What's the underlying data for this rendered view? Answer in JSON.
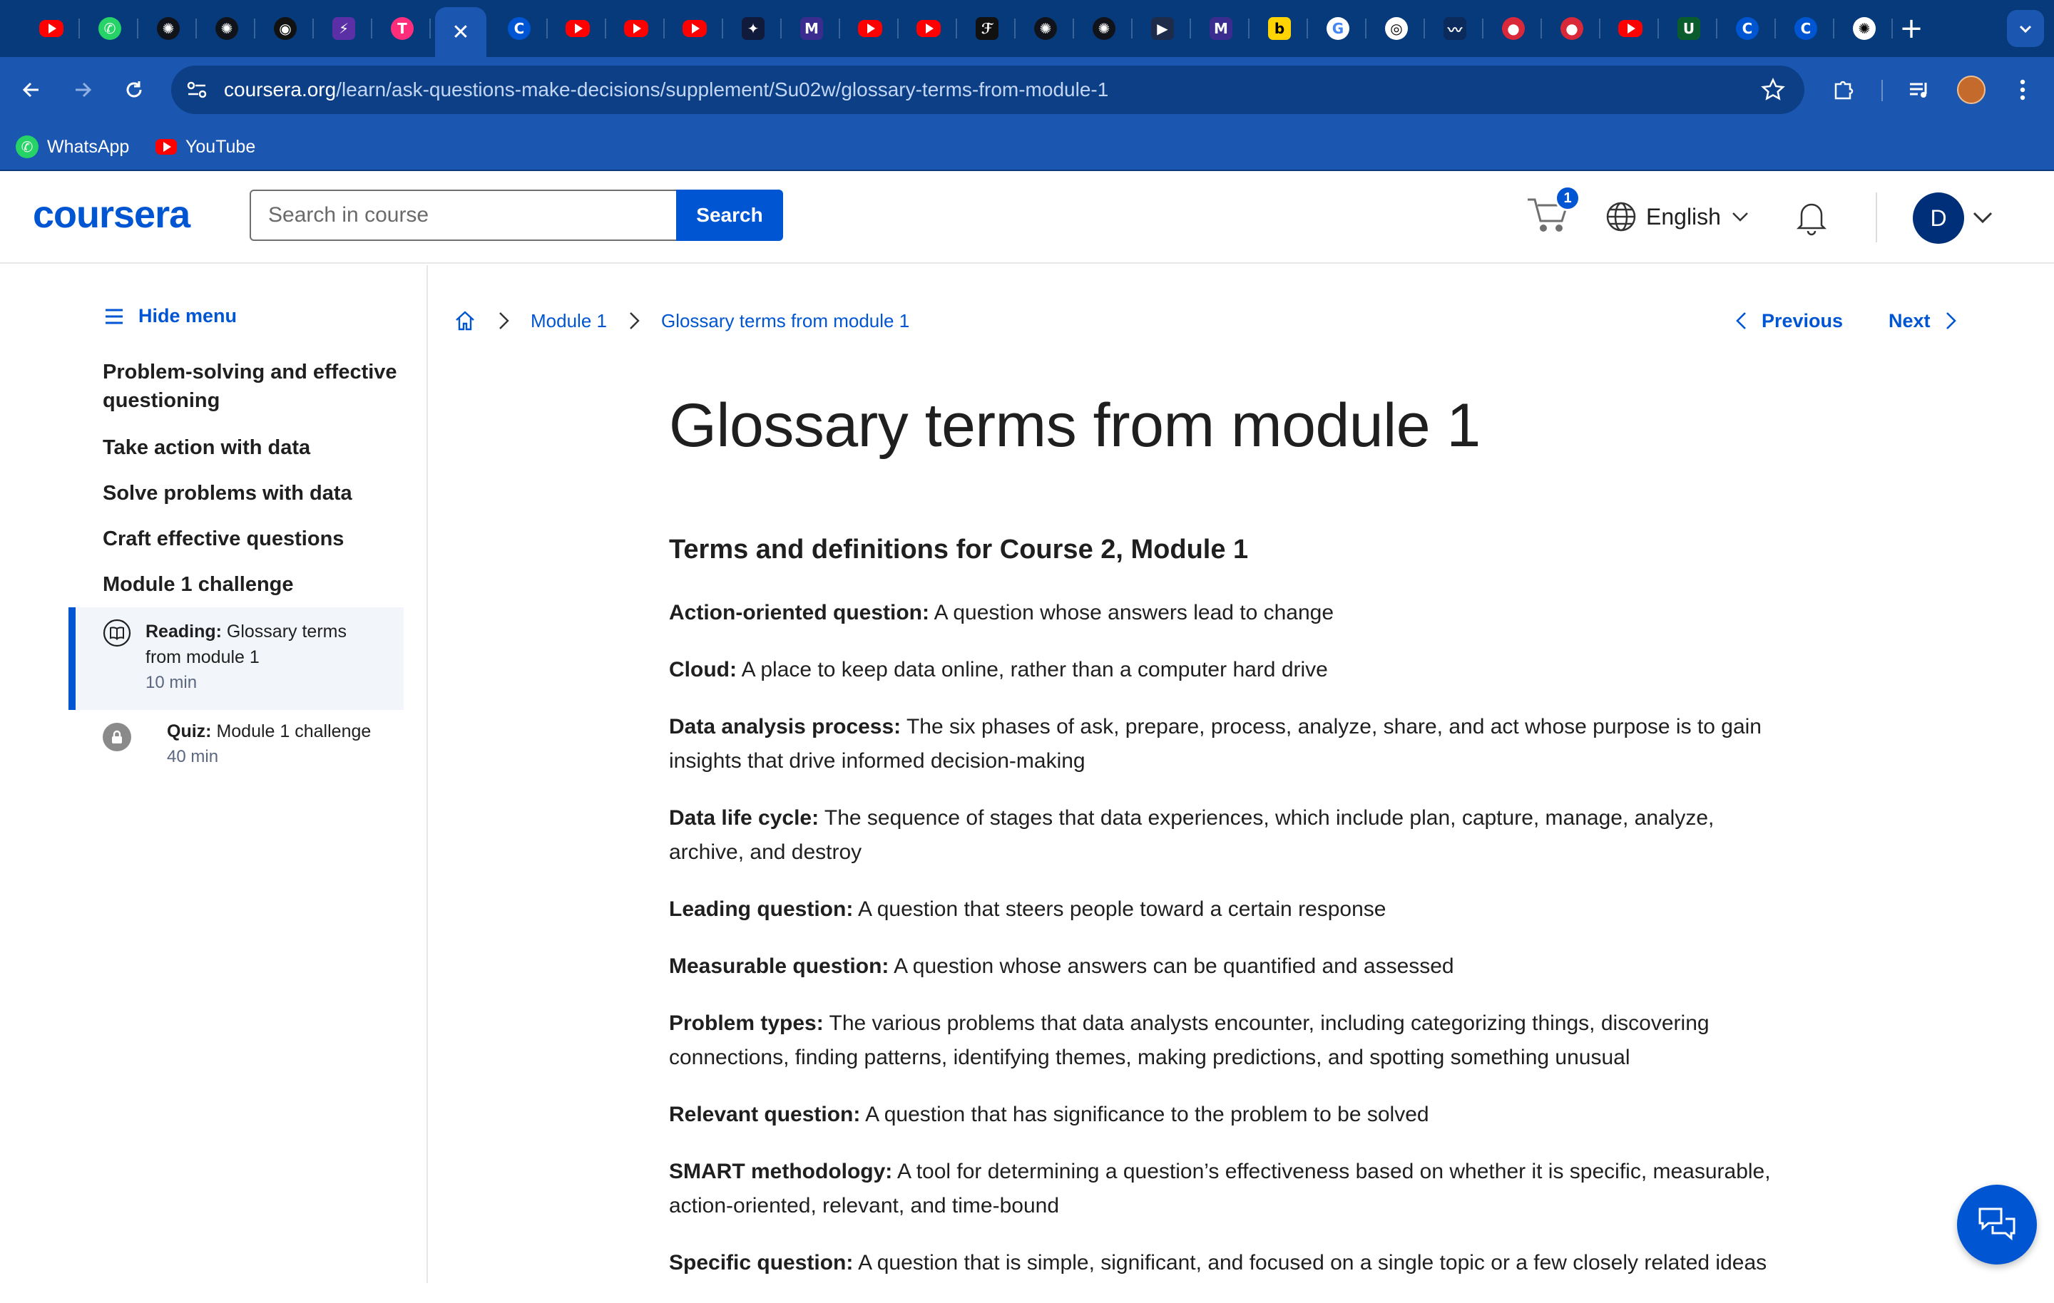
{
  "browser": {
    "tabs": [
      {
        "icon": "youtube-icon",
        "kind": "yt"
      },
      {
        "icon": "whatsapp-icon",
        "kind": "round",
        "color": "#25d366",
        "glyph": "✆"
      },
      {
        "icon": "openai-icon",
        "kind": "round",
        "color": "#10141a",
        "glyph": "✺"
      },
      {
        "icon": "openai-icon",
        "kind": "round",
        "color": "#10141a",
        "glyph": "✺"
      },
      {
        "icon": "github-icon",
        "kind": "round",
        "color": "#111111",
        "glyph": "◉"
      },
      {
        "icon": "flow-icon",
        "kind": "sq",
        "color": "#5b2fa6",
        "glyph": "⚡"
      },
      {
        "icon": "t-app-icon",
        "kind": "round",
        "color": "#ff2d7a",
        "glyph": "T"
      },
      {
        "icon": "close-tab-icon",
        "kind": "active",
        "glyph": "✕"
      },
      {
        "icon": "coursera-icon",
        "kind": "round",
        "color": "#0056d2",
        "glyph": "C"
      },
      {
        "icon": "youtube-icon",
        "kind": "yt"
      },
      {
        "icon": "youtube-icon",
        "kind": "yt"
      },
      {
        "icon": "youtube-icon",
        "kind": "yt"
      },
      {
        "icon": "space-icon",
        "kind": "sq",
        "color": "#101a3a",
        "glyph": "✦"
      },
      {
        "icon": "m-logo-icon",
        "kind": "sq",
        "color": "#3b2c8f",
        "glyph": "M"
      },
      {
        "icon": "youtube-icon",
        "kind": "yt"
      },
      {
        "icon": "youtube-icon",
        "kind": "yt"
      },
      {
        "icon": "signature-icon",
        "kind": "sq",
        "color": "#111111",
        "glyph": "ℱ"
      },
      {
        "icon": "openai-icon",
        "kind": "round",
        "color": "#10141a",
        "glyph": "✺"
      },
      {
        "icon": "openai-icon",
        "kind": "round",
        "color": "#10141a",
        "glyph": "✺"
      },
      {
        "icon": "video-icon",
        "kind": "sq",
        "color": "#1c2c4a",
        "glyph": "▶"
      },
      {
        "icon": "m-logo-icon",
        "kind": "sq",
        "color": "#3b2c8f",
        "glyph": "M"
      },
      {
        "icon": "b-logo-icon",
        "kind": "sq",
        "color": "#ffd400",
        "glyph": "b",
        "text": "#000000"
      },
      {
        "icon": "google-icon",
        "kind": "round",
        "color": "#ffffff",
        "glyph": "G",
        "text": "#4285f4"
      },
      {
        "icon": "target-icon",
        "kind": "round",
        "color": "#ffffff",
        "glyph": "◎",
        "text": "#000000"
      },
      {
        "icon": "wave-icon",
        "kind": "sq",
        "color": "#0a2b5c",
        "glyph": "〰"
      },
      {
        "icon": "red-ball-icon",
        "kind": "round",
        "color": "#d8283a",
        "glyph": "●"
      },
      {
        "icon": "red-ball-icon",
        "kind": "round",
        "color": "#d8283a",
        "glyph": "●"
      },
      {
        "icon": "youtube-icon",
        "kind": "yt"
      },
      {
        "icon": "my-unt-icon",
        "kind": "sq",
        "color": "#0b5c2c",
        "glyph": "U"
      },
      {
        "icon": "coursera-icon",
        "kind": "round",
        "color": "#0056d2",
        "glyph": "C"
      },
      {
        "icon": "coursera-icon",
        "kind": "round",
        "color": "#0056d2",
        "glyph": "C"
      },
      {
        "icon": "chatgpt-icon",
        "kind": "round",
        "color": "#ffffff",
        "glyph": "✺",
        "text": "#000000"
      }
    ],
    "url_host": "coursera.org",
    "url_path": "/learn/ask-questions-make-decisions/supplement/Su02w/glossary-terms-from-module-1",
    "bookmarks": [
      {
        "label": "WhatsApp",
        "icon": "whatsapp-icon"
      },
      {
        "label": "YouTube",
        "icon": "youtube-icon"
      }
    ]
  },
  "header": {
    "logo": "coursera",
    "search_placeholder": "Search in course",
    "search_button": "Search",
    "cart_count": "1",
    "language": "English",
    "avatar_initial": "D"
  },
  "sidebar": {
    "hide_menu": "Hide menu",
    "lessons": [
      "Problem-solving and effective questioning",
      "Take action with data",
      "Solve problems with data",
      "Craft effective questions",
      "Module 1 challenge"
    ],
    "items": [
      {
        "type": "Reading:",
        "title": "Glossary terms from module 1",
        "duration": "10 min"
      },
      {
        "type": "Quiz:",
        "title": "Module 1 challenge",
        "duration": "40 min"
      }
    ]
  },
  "breadcrumb": {
    "module": "Module 1",
    "current": "Glossary terms from module 1"
  },
  "nav": {
    "previous": "Previous",
    "next": "Next"
  },
  "content": {
    "title": "Glossary terms from module 1",
    "section_heading": "Terms and definitions for Course 2, Module 1",
    "terms": [
      {
        "term": "Action-oriented question:",
        "definition": "A question whose answers lead to change"
      },
      {
        "term": "Cloud:",
        "definition": "A place to keep data online, rather than a computer hard drive"
      },
      {
        "term": "Data analysis process:",
        "definition": "The six phases of ask, prepare, process, analyze, share, and act whose purpose is to gain insights that drive informed decision-making"
      },
      {
        "term": "Data life cycle:",
        "definition": "The sequence of stages that data experiences, which include plan, capture, manage, analyze, archive, and destroy"
      },
      {
        "term": "Leading question:",
        "definition": "A question that steers people toward a certain response"
      },
      {
        "term": "Measurable question:",
        "definition": "A question whose answers can be quantified and assessed"
      },
      {
        "term": "Problem types:",
        "definition": "The various problems that data analysts encounter, including categorizing things, discovering connections, finding patterns, identifying themes, making predictions, and spotting something unusual"
      },
      {
        "term": "Relevant question:",
        "definition": "A question that has significance to the problem to be solved"
      },
      {
        "term": "SMART methodology:",
        "definition": "A tool for determining a question’s effectiveness based on whether it is specific, measurable, action-oriented, relevant, and time-bound"
      },
      {
        "term": "Specific question:",
        "definition": "A question that is simple, significant, and focused on a single topic or a few closely related ideas"
      }
    ]
  },
  "colors": {
    "brand": "#0056d2",
    "chrome": "#1b57b0",
    "tabstrip": "#063a7a"
  }
}
